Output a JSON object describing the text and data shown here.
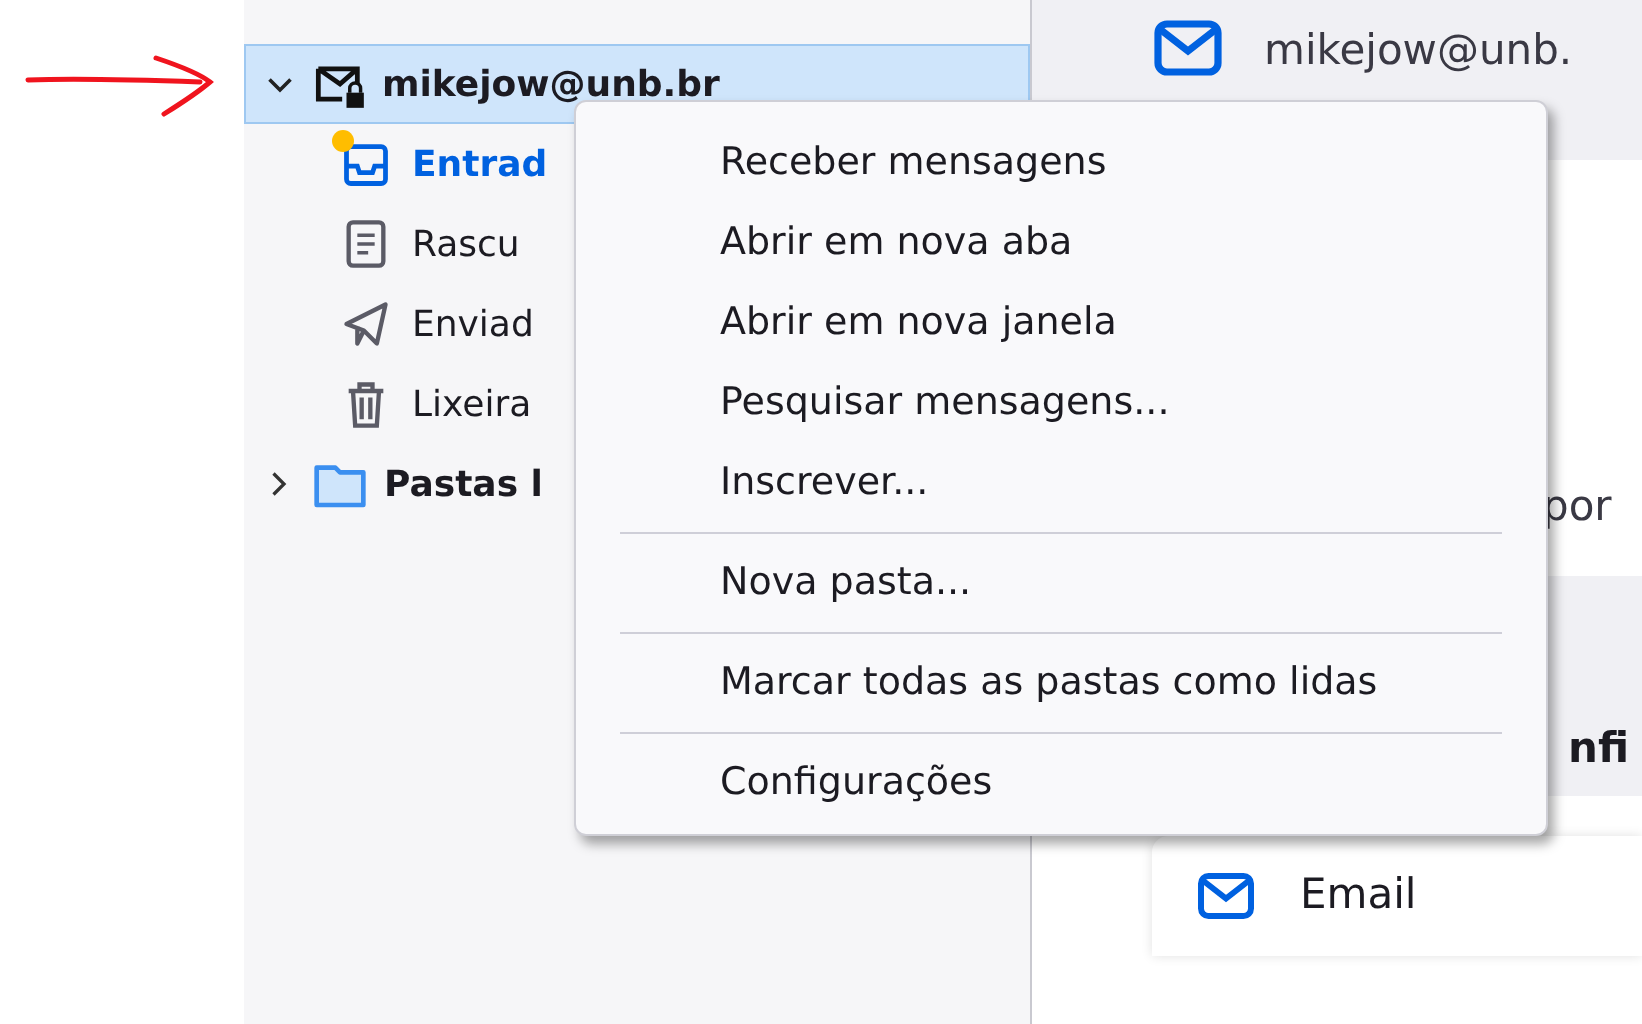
{
  "sidebar": {
    "account": {
      "label": "mikejow@unb.br",
      "expanded": true,
      "selected": true
    },
    "folders": [
      {
        "kind": "inbox",
        "label": "Entrad",
        "selected": true,
        "unread": true
      },
      {
        "kind": "drafts",
        "label": "Rascu",
        "selected": false,
        "unread": false
      },
      {
        "kind": "sent",
        "label": "Enviad",
        "selected": false,
        "unread": false
      },
      {
        "kind": "trash",
        "label": "Lixeira",
        "selected": false,
        "unread": false
      }
    ],
    "local_folders": {
      "label": "Pastas l",
      "expanded": false
    }
  },
  "main": {
    "header": "mikejow@unb.",
    "text_1": "por",
    "text_2": "nfi",
    "card_label": "Email"
  },
  "context_menu": [
    {
      "kind": "item",
      "label": "Receber mensagens"
    },
    {
      "kind": "item",
      "label": "Abrir em nova aba"
    },
    {
      "kind": "item",
      "label": "Abrir em nova janela"
    },
    {
      "kind": "item",
      "label": "Pesquisar mensagens..."
    },
    {
      "kind": "item",
      "label": "Inscrever..."
    },
    {
      "kind": "separator"
    },
    {
      "kind": "item",
      "label": "Nova pasta..."
    },
    {
      "kind": "separator"
    },
    {
      "kind": "item",
      "label": "Marcar todas as pastas como lidas"
    },
    {
      "kind": "separator"
    },
    {
      "kind": "item",
      "label": "Configurações"
    }
  ]
}
